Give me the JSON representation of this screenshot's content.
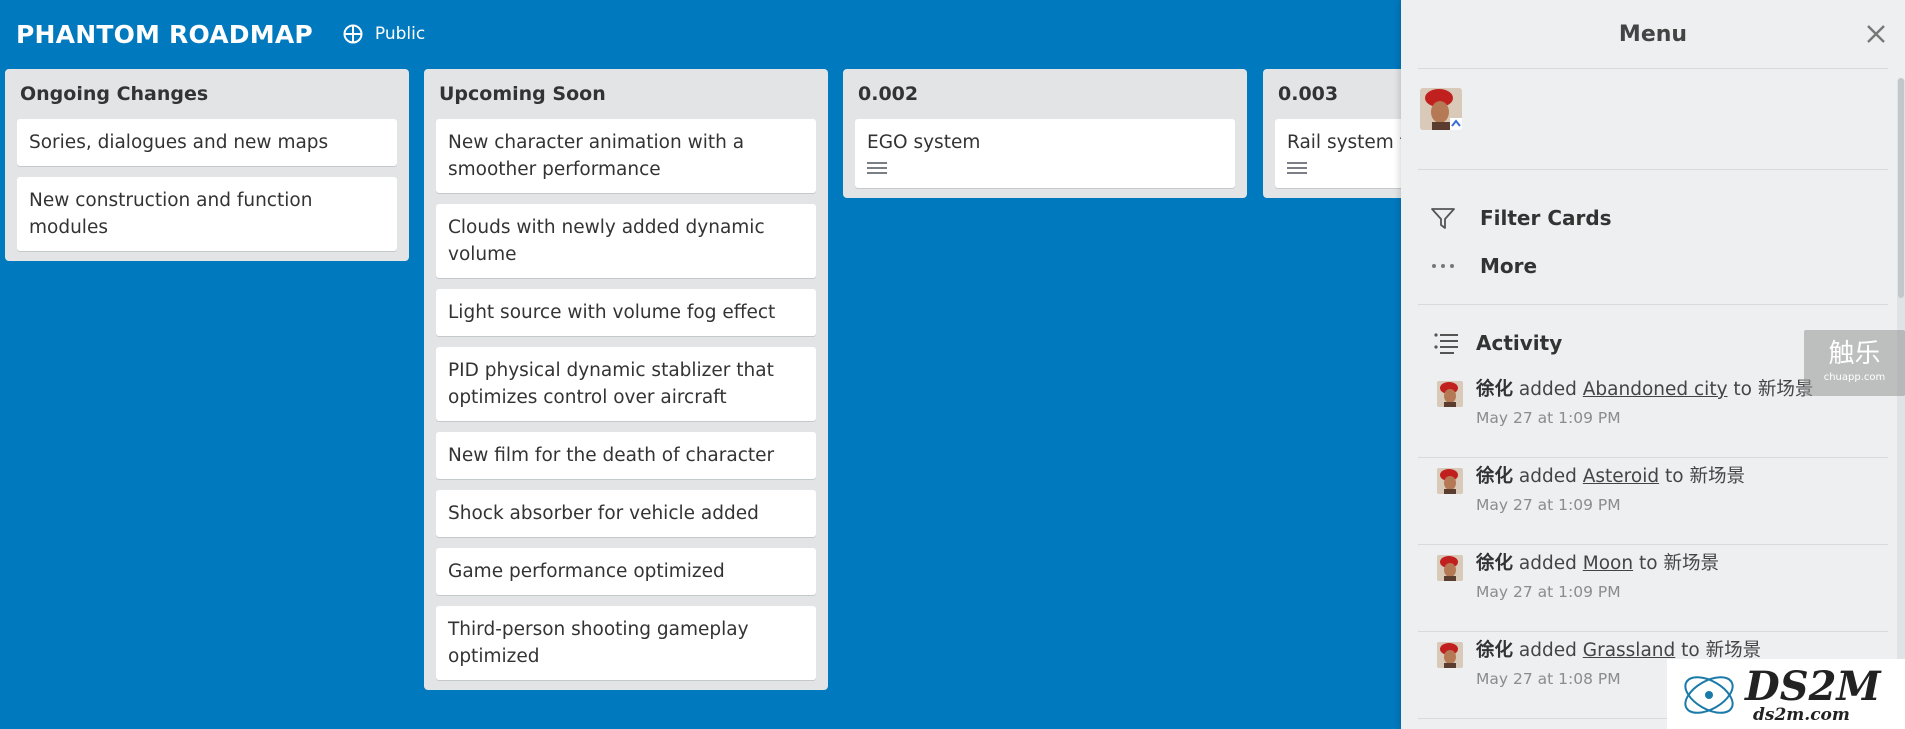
{
  "board": {
    "title": "PHANTOM ROADMAP",
    "visibility": "Public",
    "background_color": "#0079bf"
  },
  "lists": [
    {
      "title": "Ongoing Changes",
      "cards": [
        {
          "text": "Sories, dialogues and new maps",
          "has_description": false
        },
        {
          "text": "New construction and function modules",
          "has_description": false
        }
      ]
    },
    {
      "title": "Upcoming Soon",
      "cards": [
        {
          "text": "New character animation with a smoother performance",
          "has_description": false
        },
        {
          "text": "Clouds with newly added dynamic volume",
          "has_description": false
        },
        {
          "text": "Light source with volume fog effect",
          "has_description": false
        },
        {
          "text": "PID physical dynamic stablizer that optimizes control over aircraft",
          "has_description": false
        },
        {
          "text": "New film for the death of character",
          "has_description": false
        },
        {
          "text": "Shock absorber for vehicle added",
          "has_description": false
        },
        {
          "text": "Game performance optimized",
          "has_description": false
        },
        {
          "text": "Third-person shooting gameplay optimized",
          "has_description": false
        }
      ]
    },
    {
      "title": "0.002",
      "cards": [
        {
          "text": "EGO system",
          "has_description": true
        }
      ]
    },
    {
      "title": "0.003",
      "cards": [
        {
          "text": "Rail system for new large map",
          "has_description": true
        }
      ]
    }
  ],
  "menu": {
    "title": "Menu",
    "close_icon": "close-icon",
    "actions": [
      {
        "label": "Filter Cards",
        "icon": "filter-icon"
      },
      {
        "label": "More",
        "icon": "more-icon"
      }
    ],
    "activity_label": "Activity",
    "activity": [
      {
        "user": "徐化",
        "verb": "added",
        "item": "Abandoned city",
        "prep": "to",
        "target": "新场景",
        "time": "May 27 at 1:09 PM"
      },
      {
        "user": "徐化",
        "verb": "added",
        "item": "Asteroid",
        "prep": "to",
        "target": "新场景",
        "time": "May 27 at 1:09 PM"
      },
      {
        "user": "徐化",
        "verb": "added",
        "item": "Moon",
        "prep": "to",
        "target": "新场景",
        "time": "May 27 at 1:09 PM"
      },
      {
        "user": "徐化",
        "verb": "added",
        "item": "Grassland",
        "prep": "to",
        "target": "新场景",
        "time": "May 27 at 1:08 PM"
      }
    ]
  },
  "watermarks": {
    "chuapp_big": "触乐",
    "chuapp_small": "chuapp.com",
    "ds2m_big": "DS2M",
    "ds2m_small": "ds2m.com"
  }
}
